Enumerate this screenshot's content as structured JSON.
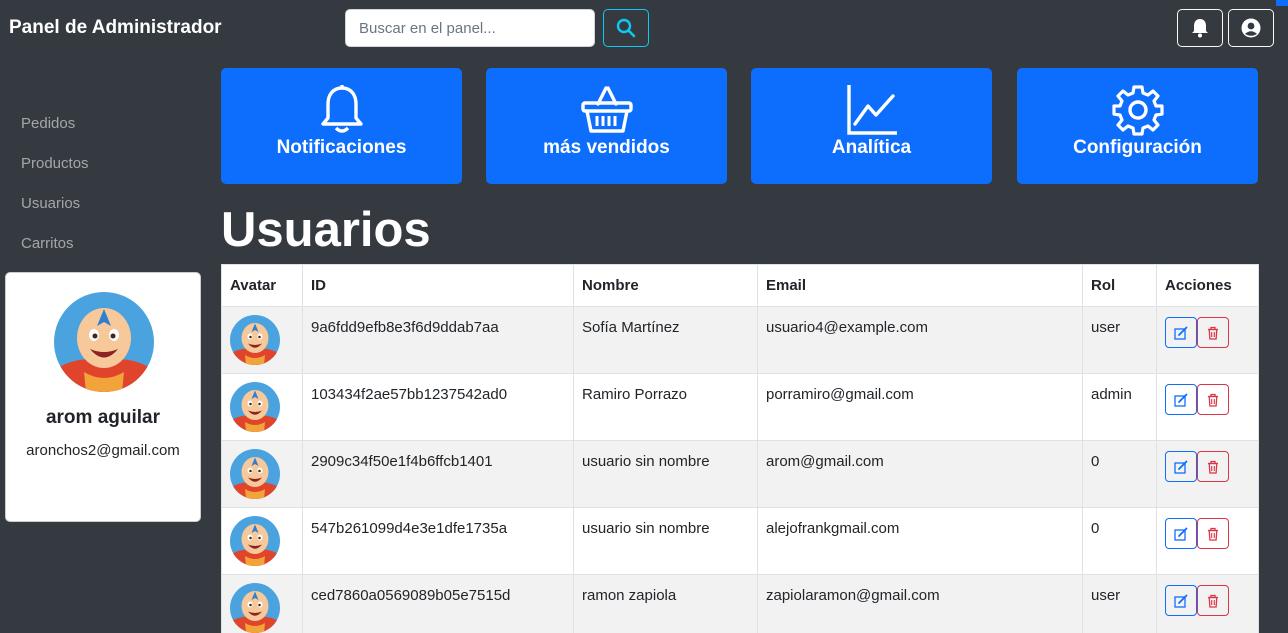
{
  "header": {
    "brand": "Panel de Administrador",
    "search_placeholder": "Buscar en el panel..."
  },
  "sidebar": {
    "items": [
      {
        "label": "Pedidos"
      },
      {
        "label": "Productos"
      },
      {
        "label": "Usuarios"
      },
      {
        "label": "Carritos"
      }
    ]
  },
  "profile": {
    "name": "arom aguilar",
    "email": "aronchos2@gmail.com"
  },
  "tiles": [
    {
      "label": "Notificaciones",
      "icon": "bell-icon"
    },
    {
      "label": "más vendidos",
      "icon": "basket-icon"
    },
    {
      "label": "Analítica",
      "icon": "graph-up-icon"
    },
    {
      "label": "Configuración",
      "icon": "gear-icon"
    }
  ],
  "page": {
    "title": "Usuarios"
  },
  "table": {
    "headers": [
      "Avatar",
      "ID",
      "Nombre",
      "Email",
      "Rol",
      "Acciones"
    ],
    "rows": [
      {
        "id": "9a6fdd9efb8e3f6d9ddab7aa",
        "name": "Sofía Martínez",
        "email": "usuario4@example.com",
        "role": "user"
      },
      {
        "id": "103434f2ae57bb1237542ad0",
        "name": "Ramiro Porrazo",
        "email": "porramiro@gmail.com",
        "role": "admin"
      },
      {
        "id": "2909c34f50e1f4b6ffcb1401",
        "name": "usuario sin nombre",
        "email": "arom@gmail.com",
        "role": "0"
      },
      {
        "id": "547b261099d4e3e1dfe1735a",
        "name": "usuario sin nombre",
        "email": "alejofrankgmail.com",
        "role": "0"
      },
      {
        "id": "ced7860a0569089b05e7515d",
        "name": "ramon zapiola",
        "email": "zapiolaramon@gmail.com",
        "role": "user"
      }
    ]
  },
  "colors": {
    "background": "#343a40",
    "primary": "#0d6efd",
    "info": "#0dcaf0",
    "danger": "#dc3545"
  }
}
